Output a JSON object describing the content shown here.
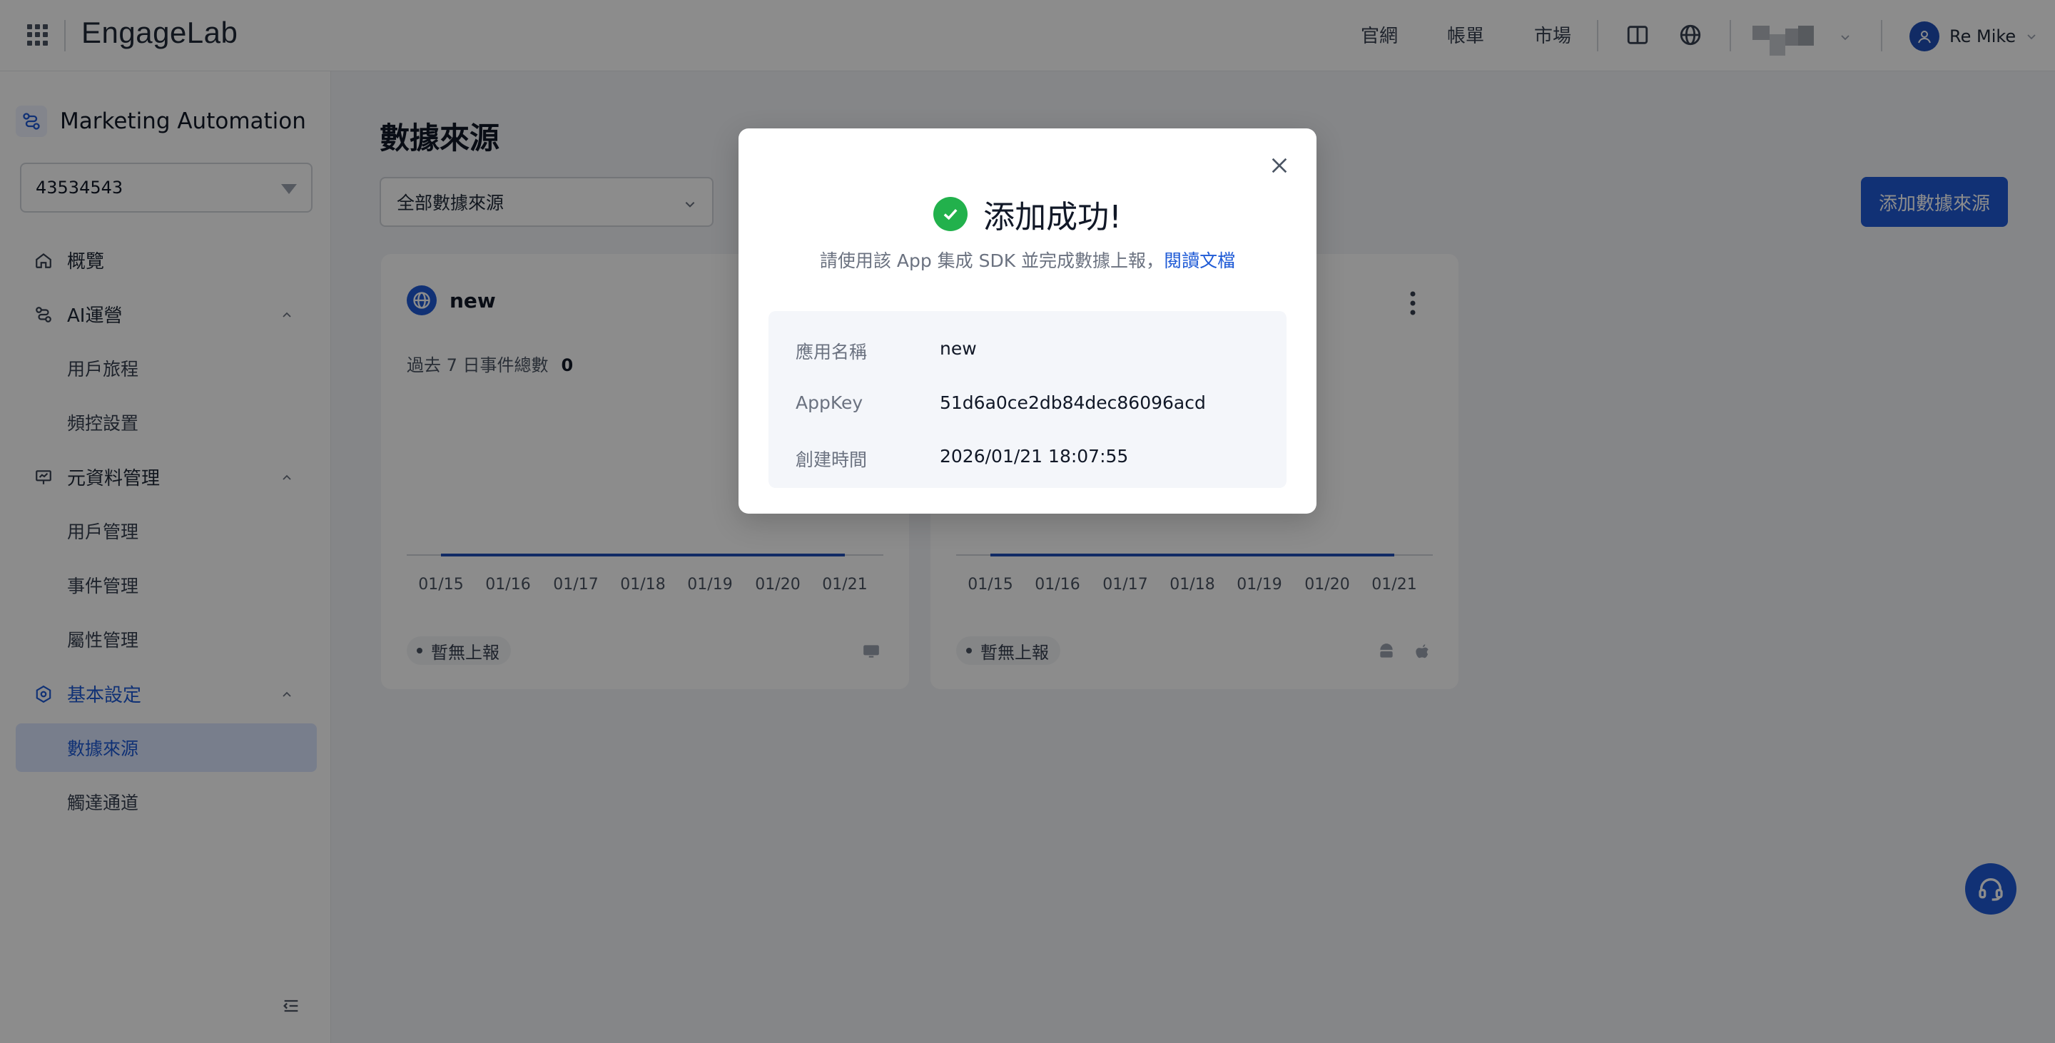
{
  "topbar": {
    "logo": "EngageLab",
    "links": [
      "官網",
      "帳單",
      "市場"
    ],
    "user_name": "Re Mike"
  },
  "sidebar": {
    "product_title": "Marketing Automation",
    "account_id": "43534543",
    "items": {
      "overview": "概覽",
      "ai_ops": "AI運營",
      "user_journey": "用戶旅程",
      "frequency": "頻控設置",
      "metadata": "元資料管理",
      "user_mgmt": "用戶管理",
      "event_mgmt": "事件管理",
      "attr_mgmt": "屬性管理",
      "basic_settings": "基本設定",
      "data_source": "數據來源",
      "channels": "觸達通道"
    }
  },
  "main": {
    "page_title": "數據來源",
    "filter_value": "全部數據來源",
    "add_button": "添加數據來源",
    "cards": [
      {
        "name": "new",
        "metric_label": "過去 7 日事件總數",
        "metric_value": "0",
        "x_labels": [
          "01/15",
          "01/16",
          "01/17",
          "01/18",
          "01/19",
          "01/20",
          "01/21"
        ],
        "status": "暫無上報"
      },
      {
        "x_labels": [
          "01/15",
          "01/16",
          "01/17",
          "01/18",
          "01/19",
          "01/20",
          "01/21"
        ],
        "status": "暫無上報"
      }
    ]
  },
  "modal": {
    "title": "添加成功!",
    "subtitle": "請使用該 App 集成 SDK 並完成數據上報，",
    "doc_link": "閱讀文檔",
    "rows": [
      {
        "key": "應用名稱",
        "value": "new"
      },
      {
        "key": "AppKey",
        "value": "51d6a0ce2db84dec86096acd"
      },
      {
        "key": "創建時間",
        "value": "2026/01/21 18:07:55"
      }
    ]
  },
  "colors": {
    "brand": "#1f5ad6",
    "success": "#22b14c",
    "active_nav_bg": "#dbe6ff"
  }
}
